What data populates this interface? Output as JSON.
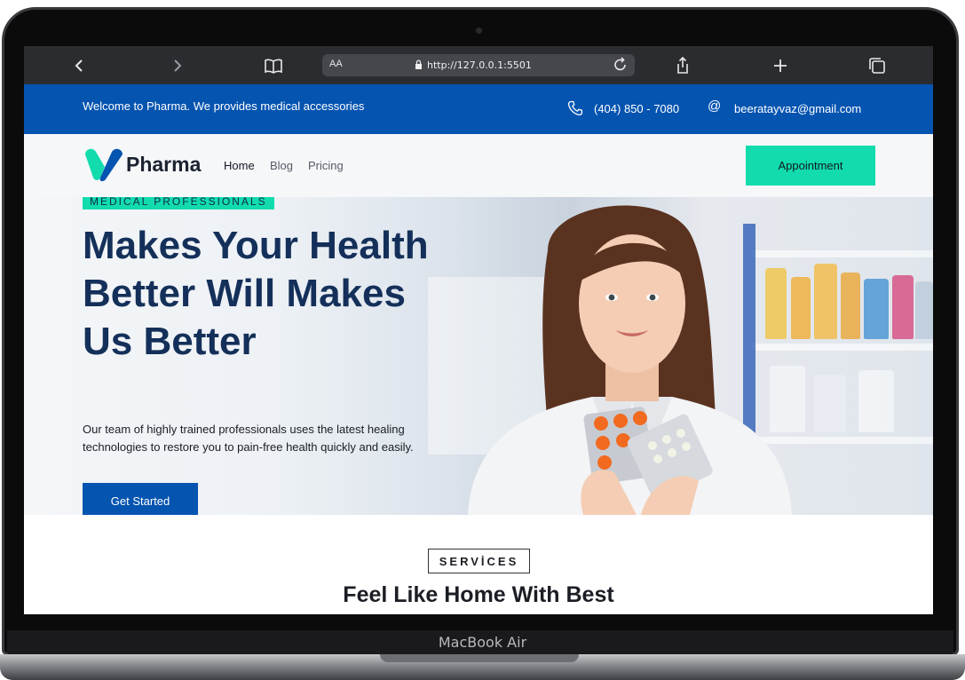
{
  "device": {
    "label": "MacBook Air"
  },
  "browser": {
    "text_size_label": "AA",
    "url": "http://127.0.0.1:5501",
    "icons": [
      "back-icon",
      "forward-icon",
      "bookmarks-icon",
      "lock-icon",
      "reload-icon",
      "share-icon",
      "new-tab-icon",
      "tabs-icon"
    ]
  },
  "topbar": {
    "welcome": "Welcome to Pharma. We provides medical accessories",
    "phone": "(404) 850 - 7080",
    "email": "beeratayvaz@gmail.com"
  },
  "nav": {
    "brand": "Pharma",
    "links": [
      "Home",
      "Blog",
      "Pricing"
    ],
    "appointment_label": "Appointment"
  },
  "hero": {
    "badge": "MEDICAL PROFESSIONALS",
    "title": "Makes Your Health Better Will Makes Us Better",
    "text": "Our team of highly trained professionals uses the latest healing technologies to restore you to pain-free health quickly and easily.",
    "cta_label": "Get Started"
  },
  "services": {
    "label": "SERVİCES",
    "title": "Feel Like Home With Best"
  },
  "colors": {
    "primary": "#0554b0",
    "accent": "#12dcae",
    "heading": "#14305a"
  }
}
